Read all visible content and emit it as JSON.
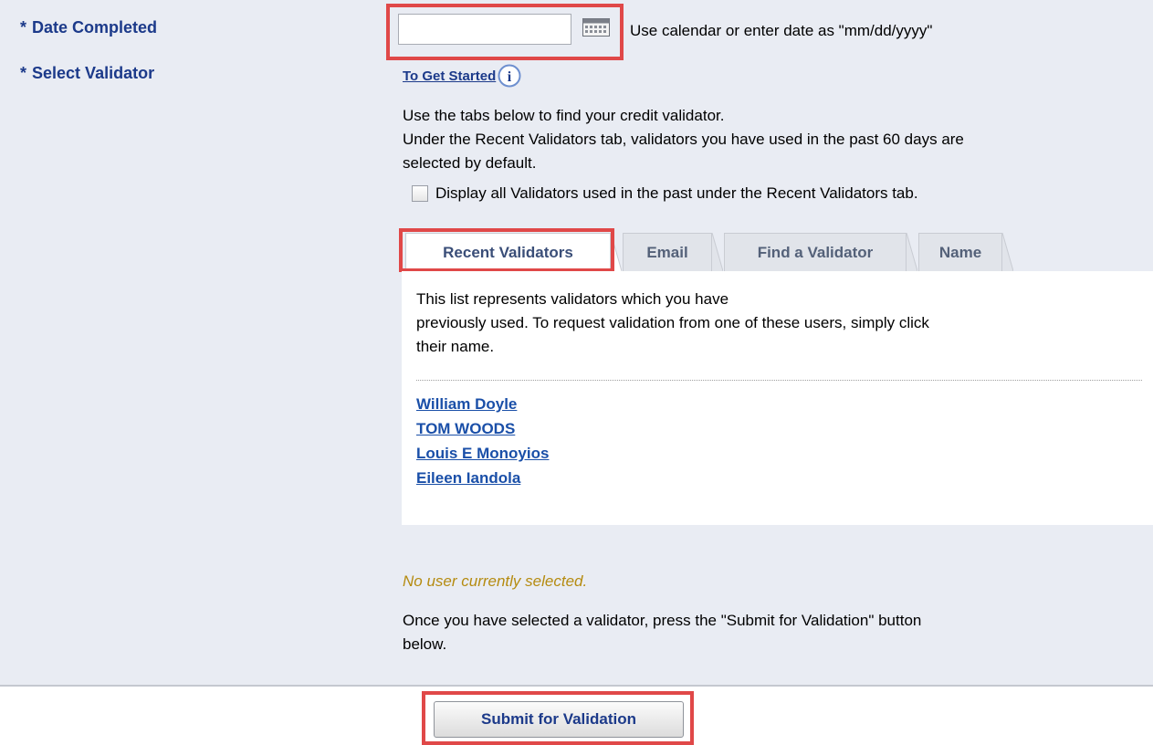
{
  "fields": {
    "date_completed": {
      "required_mark": "*",
      "label": "Date Completed"
    },
    "select_validator": {
      "required_mark": "*",
      "label": "Select Validator"
    }
  },
  "date_input": {
    "value": "",
    "placeholder": ""
  },
  "date_hint": "Use calendar or enter date as \"mm/dd/yyyy\"",
  "icons": {
    "calendar": "calendar-icon",
    "info": "info-icon"
  },
  "get_started": {
    "link": "To Get Started",
    "info_glyph": "i"
  },
  "instructions": {
    "line1": "Use the tabs below to find your credit validator.",
    "line2": "Under the Recent Validators tab, validators you have used in the past 60 days are",
    "line3": "selected by default."
  },
  "checkbox": {
    "label": "Display all Validators used in the past under the Recent Validators tab.",
    "checked": false
  },
  "tabs": [
    {
      "label": "Recent Validators",
      "active": true
    },
    {
      "label": "Email",
      "active": false
    },
    {
      "label": "Find a Validator",
      "active": false
    },
    {
      "label": "Name",
      "active": false
    }
  ],
  "panel": {
    "line1": "This list represents validators which you have",
    "line2": "previously used. To request validation from one of these users, simply click",
    "line3": "their name."
  },
  "validators": [
    "William Doyle",
    "TOM WOODS",
    "Louis E Monoyios",
    "Eileen Iandola"
  ],
  "status": "No user currently selected.",
  "submit_instructions": {
    "line1": "Once you have selected a validator, press the \"Submit for Validation\" button",
    "line2": "below."
  },
  "submit_button": "Submit for Validation",
  "colors": {
    "form_background": "#e9ecf3",
    "label_blue": "#1c3a8a",
    "link_blue": "#1a4fa8",
    "highlight_red": "#e04848",
    "status_gold": "#b58b10"
  }
}
